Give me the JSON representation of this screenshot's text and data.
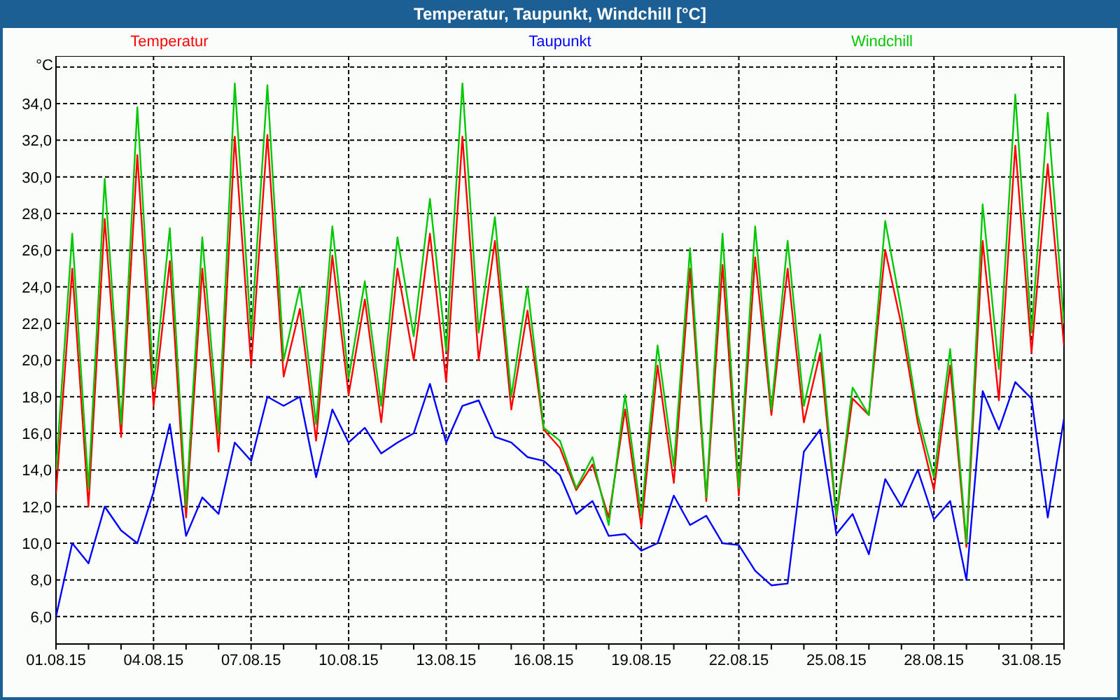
{
  "window": {
    "title": "Temperatur, Taupunkt, Windchill [°C]"
  },
  "chart": {
    "chart_data": {
      "type": "line",
      "ylabel": "°C",
      "grid": true,
      "ylim": [
        4.5,
        36.6
      ],
      "categories": [
        "01.08.15",
        null,
        null,
        null,
        null,
        null,
        "04.08.15",
        null,
        null,
        null,
        null,
        null,
        "07.08.15",
        null,
        null,
        null,
        null,
        null,
        "10.08.15",
        null,
        null,
        null,
        null,
        null,
        "13.08.15",
        null,
        null,
        null,
        null,
        null,
        "16.08.15",
        null,
        null,
        null,
        null,
        null,
        "19.08.15",
        null,
        null,
        null,
        null,
        null,
        "22.08.15",
        null,
        null,
        null,
        null,
        null,
        "25.08.15",
        null,
        null,
        null,
        null,
        null,
        "28.08.15",
        null,
        null,
        null,
        null,
        null,
        "31.08.15",
        null,
        null
      ],
      "yticks": [
        {
          "value": 6,
          "label": "6,0"
        },
        {
          "value": 8,
          "label": "8,0"
        },
        {
          "value": 10,
          "label": "10,0"
        },
        {
          "value": 12,
          "label": "12,0"
        },
        {
          "value": 14,
          "label": "14,0"
        },
        {
          "value": 16,
          "label": "16,0"
        },
        {
          "value": 18,
          "label": "18,0"
        },
        {
          "value": 20,
          "label": "20,0"
        },
        {
          "value": 22,
          "label": "22,0"
        },
        {
          "value": 24,
          "label": "24,0"
        },
        {
          "value": 26,
          "label": "26,0"
        },
        {
          "value": 28,
          "label": "28,0"
        },
        {
          "value": 30,
          "label": "30,0"
        },
        {
          "value": 32,
          "label": "32,0"
        },
        {
          "value": 34,
          "label": "34,0"
        }
      ],
      "series": [
        {
          "name": "Temperatur",
          "color": "#ff0000",
          "values": [
            12.7,
            25.0,
            12.0,
            27.7,
            15.8,
            31.2,
            17.5,
            25.4,
            11.4,
            25.0,
            15.0,
            32.2,
            19.7,
            32.3,
            19.1,
            22.8,
            15.6,
            25.7,
            18.1,
            23.3,
            16.6,
            25.0,
            20.0,
            26.9,
            18.8,
            32.2,
            20.0,
            26.5,
            17.3,
            22.7,
            16.2,
            15.2,
            12.9,
            14.3,
            11.4,
            17.3,
            10.9,
            19.7,
            13.3,
            25.0,
            12.3,
            25.2,
            12.6,
            25.6,
            17.0,
            25.0,
            16.6,
            20.4,
            11.4,
            17.9,
            17.0,
            26.0,
            21.9,
            16.6,
            12.9,
            19.7,
            9.8,
            26.5,
            17.8,
            31.7,
            20.4,
            30.7,
            20.8
          ]
        },
        {
          "name": "Taupunkt",
          "color": "#0000ff",
          "values": [
            6.0,
            10.0,
            8.9,
            12.0,
            10.7,
            10.0,
            12.8,
            16.5,
            10.4,
            12.5,
            11.6,
            15.5,
            14.5,
            18.0,
            17.5,
            18.0,
            13.6,
            17.3,
            15.5,
            16.3,
            14.9,
            15.5,
            16.0,
            18.7,
            15.5,
            17.5,
            17.8,
            15.8,
            15.5,
            14.7,
            14.5,
            13.7,
            11.6,
            12.3,
            10.4,
            10.5,
            9.6,
            10.0,
            12.6,
            11.0,
            11.5,
            10.0,
            9.9,
            8.5,
            7.7,
            7.8,
            15.0,
            16.2,
            10.5,
            11.6,
            9.4,
            13.5,
            12.0,
            14.0,
            11.3,
            12.3,
            8.0,
            18.3,
            16.2,
            18.8,
            17.9,
            11.4,
            16.8
          ]
        },
        {
          "name": "Windchill",
          "color": "#00c800",
          "values": [
            14.0,
            26.9,
            13.0,
            29.9,
            16.5,
            33.8,
            18.5,
            27.2,
            12.0,
            26.7,
            16.0,
            35.1,
            21.3,
            35.0,
            20.0,
            24.0,
            16.5,
            27.3,
            19.0,
            24.3,
            17.5,
            26.7,
            21.3,
            28.8,
            20.5,
            35.1,
            21.5,
            27.8,
            18.0,
            24.0,
            16.3,
            15.6,
            13.0,
            14.7,
            11.0,
            18.1,
            11.5,
            20.8,
            14.2,
            26.1,
            12.5,
            26.9,
            13.0,
            27.3,
            17.3,
            26.5,
            17.5,
            21.4,
            11.5,
            18.5,
            17.0,
            27.6,
            22.7,
            17.0,
            13.6,
            20.6,
            10.0,
            28.5,
            19.5,
            34.5,
            21.5,
            33.5,
            22.0
          ]
        }
      ]
    }
  }
}
